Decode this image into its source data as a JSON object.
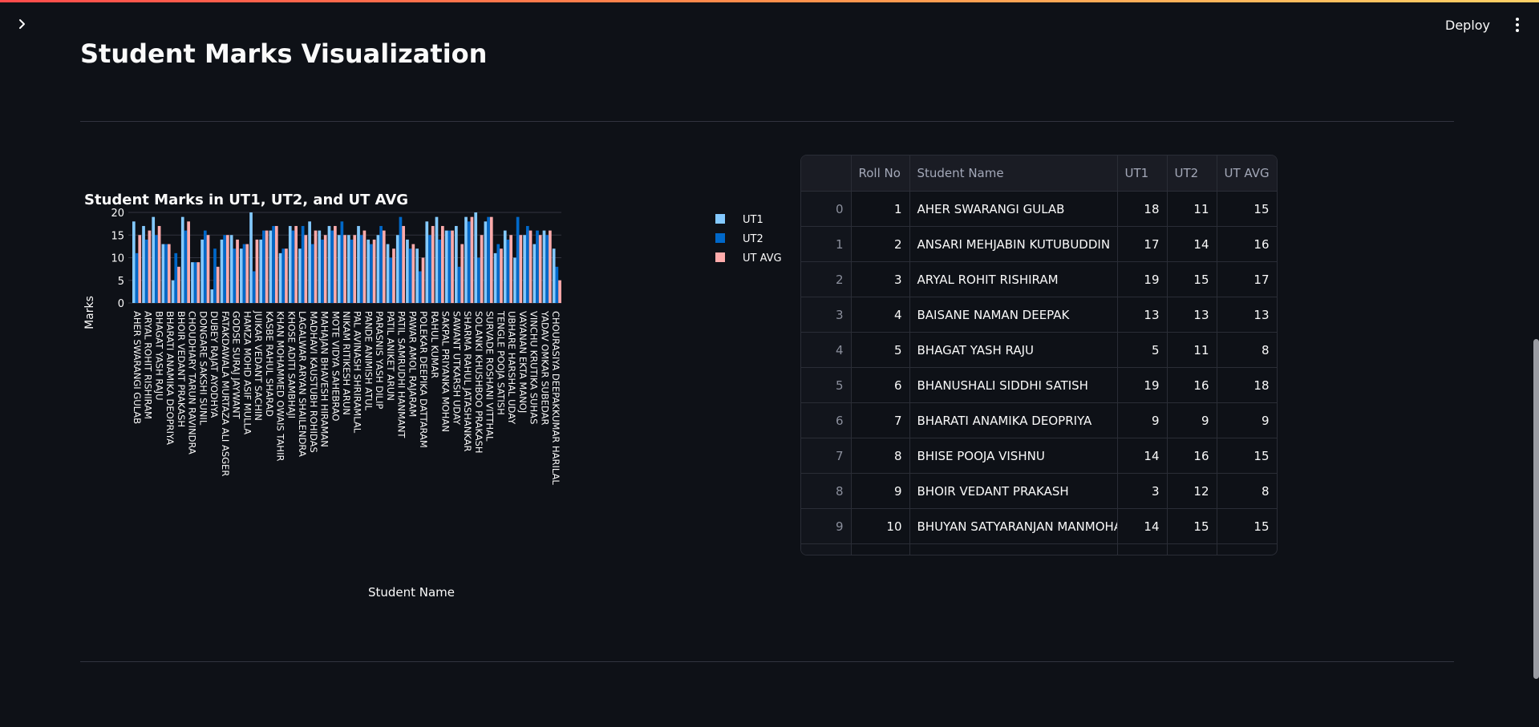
{
  "app": {
    "deploy_label": "Deploy",
    "page_title": "Student Marks Visualization"
  },
  "icons": {
    "sidebar_toggle": "chevron-right-icon",
    "main_menu": "more-vertical-icon"
  },
  "chart_data": {
    "type": "bar",
    "title": "Student Marks in UT1, UT2, and UT AVG",
    "xlabel": "Student Name",
    "ylabel": "Marks",
    "ylim": [
      0,
      20
    ],
    "yticks": [
      0,
      5,
      10,
      15,
      20
    ],
    "grid": true,
    "legend_placement": "right",
    "colors": {
      "UT1": "#83c9ff",
      "UT2": "#0068c9",
      "UT AVG": "#ffabab"
    },
    "categories": [
      "AHER SWARANGI GULAB",
      "ANSARI MEHJABIN KUTUBUDDIN",
      "ARYAL ROHIT RISHIRAM",
      "BAISANE NAMAN DEEPAK",
      "BHAGAT YASH RAJU",
      "BHANUSHALI SIDDHI SATISH",
      "BHARATI ANAMIKA DEOPRIYA",
      "BHISE POOJA VISHNU",
      "BHOIR VEDANT PRAKASH",
      "BHUYAN SATYARANJAN MANMOHAN",
      "CHOUDHARY TARUN RAVINDRA",
      "CHOURASIYA DEEPAKKUMAR HARILAL",
      "DONGARE SAKSHI SUNIL",
      "DUBEY RAJAT AYODHYA",
      "FATAKDAWALA MURTAZA ALI ASGER",
      "GODSE SURAJ JAYWANT",
      "HAMZA MOHD ASIF MULLA",
      "JUIKAR VEDANT SACHIN",
      "KASBE RAHUL SHARAD",
      "KHAN MOHAMMED OWAIS TAHIR",
      "KHOSE ADITI SAMBHAJI",
      "LAGALWAR ARYAN SHAILENDRA",
      "MADHAVI KAUSTUBH ROHIDAS",
      "MAHAJAN BHAVESH HIRAMAN",
      "MOTE VIDYA SAHEBRAO",
      "NIKAM RITIKESH ARUN",
      "PAL AVINASH SHRIRAMLAL",
      "PANDE ANIMISH ATUL",
      "PARASNIS YASH DILIP",
      "PATIL ANIKET ARUN",
      "PATIL SAMRUDHI HANMANT",
      "PAWAR AMOL RAJARAM",
      "POLEKAR DEEPIKA DATTARAM",
      "RAHUL KUMAR",
      "SAKPAL PRIYANKA MOHAN",
      "SAWANT UTKARSH UDAY",
      "SHARMA RAHUL JATASHANKAR",
      "SOLANKI KHUSHBOO PRAKASH",
      "SURVADE ROSHANI VITTHAL",
      "TENGLE POOJA SATISH",
      "UBHARE HARSHAL UDAY",
      "VAYANAN EKTA MANOJ",
      "VINCHU KRUTIKA SUHAS",
      "YADAV OMKAR SUBEDAR"
    ],
    "tick_labels_shown": [
      "AHER SWARANGI GULAB",
      "ARYAL ROHIT RISHIRAM",
      "BHAGAT YASH RAJU",
      "BHARATI ANAMIKA DEOPRIYA",
      "BHOIR VEDANT PRAKASH",
      "CHOUDHARY TARUN RAVINDRA",
      "DONGARE SAKSHI SUNIL",
      "DUBEY RAJAT AYODHYA",
      "FATAKDAWALA MURTAZA ALI ASGER",
      "GODSE SURAJ JAYWANT",
      "HAMZA MOHD ASIF MULLA",
      "JUIKAR VEDANT SACHIN",
      "KASBE RAHUL SHARAD",
      "KHAN MOHAMMED OWAIS TAHIR",
      "KHOSE ADITI SAMBHAJI",
      "LAGALWAR ARYAN SHAILENDRA",
      "MADHAVI KAUSTUBH ROHIDAS",
      "MAHAJAN BHAVESH HIRAMAN",
      "MOTE VIDYA SAHEBRAO",
      "NIKAM RITIKESH ARUN",
      "PAL AVINASH SHRIRAMLAL",
      "PANDE ANIMISH ATUL",
      "PARASNIS YASH DILIP",
      "PATIL ANIKET ARUN",
      "PATIL SAMRUDHI HANMANT",
      "PAWAR AMOL RAJARAM",
      "POLEKAR DEEPIKA DATTARAM",
      "RAHUL KUMAR",
      "SAKPAL PRIYANKA MOHAN",
      "SAWANT UTKARSH UDAY",
      "SHARMA RAHUL JATASHANKAR",
      "SOLANKI KHUSHBOO PRAKASH",
      "SURVADE ROSHANI VITTHAL",
      "TENGLE POOJA SATISH",
      "UBHARE HARSHAL UDAY",
      "VAYANAN EKTA MANOJ",
      "VINCHU KRUTIKA SUHAS",
      "YADAV OMKAR SUBEDAR",
      "CHOURASIYA DEEPAKKUMAR HARILAL"
    ],
    "series": [
      {
        "name": "UT1",
        "values": [
          18,
          17,
          19,
          13,
          5,
          19,
          9,
          14,
          3,
          14,
          15,
          12,
          20,
          14,
          16,
          11,
          17,
          12,
          18,
          16,
          17,
          15,
          15,
          17,
          14,
          15,
          13,
          15,
          14,
          12,
          18,
          19,
          16,
          17,
          19,
          20,
          18,
          11,
          16,
          10,
          15,
          13,
          16,
          12
        ]
      },
      {
        "name": "UT2",
        "values": [
          11,
          14,
          15,
          13,
          11,
          16,
          9,
          16,
          12,
          15,
          12,
          13,
          7,
          16,
          17,
          12,
          16,
          17,
          13,
          14,
          16,
          18,
          14,
          15,
          13,
          17,
          10,
          19,
          12,
          7,
          15,
          14,
          16,
          8,
          18,
          10,
          19,
          13,
          14,
          19,
          17,
          16,
          15,
          8
        ]
      },
      {
        "name": "UT AVG",
        "values": [
          15,
          16,
          17,
          13,
          8,
          18,
          9,
          15,
          8,
          15,
          14,
          13,
          14,
          16,
          17,
          12,
          17,
          15,
          16,
          15,
          17,
          15,
          15,
          16,
          14,
          16,
          12,
          17,
          13,
          10,
          17,
          17,
          16,
          13,
          19,
          15,
          19,
          12,
          15,
          15,
          16,
          15,
          16,
          5
        ]
      }
    ]
  },
  "table": {
    "index_header": "",
    "columns": [
      "Roll No",
      "Student Name",
      "UT1",
      "UT2",
      "UT AVG"
    ],
    "rows": [
      {
        "idx": "0",
        "roll": "1",
        "name": "AHER SWARANGI GULAB",
        "ut1": "18",
        "ut2": "11",
        "avg": "15"
      },
      {
        "idx": "1",
        "roll": "2",
        "name": "ANSARI MEHJABIN KUTUBUDDIN",
        "ut1": "17",
        "ut2": "14",
        "avg": "16"
      },
      {
        "idx": "2",
        "roll": "3",
        "name": "ARYAL ROHIT RISHIRAM",
        "ut1": "19",
        "ut2": "15",
        "avg": "17"
      },
      {
        "idx": "3",
        "roll": "4",
        "name": "BAISANE NAMAN DEEPAK",
        "ut1": "13",
        "ut2": "13",
        "avg": "13"
      },
      {
        "idx": "4",
        "roll": "5",
        "name": "BHAGAT YASH RAJU",
        "ut1": "5",
        "ut2": "11",
        "avg": "8"
      },
      {
        "idx": "5",
        "roll": "6",
        "name": "BHANUSHALI SIDDHI SATISH",
        "ut1": "19",
        "ut2": "16",
        "avg": "18"
      },
      {
        "idx": "6",
        "roll": "7",
        "name": "BHARATI ANAMIKA DEOPRIYA",
        "ut1": "9",
        "ut2": "9",
        "avg": "9"
      },
      {
        "idx": "7",
        "roll": "8",
        "name": "BHISE POOJA VISHNU",
        "ut1": "14",
        "ut2": "16",
        "avg": "15"
      },
      {
        "idx": "8",
        "roll": "9",
        "name": "BHOIR VEDANT PRAKASH",
        "ut1": "3",
        "ut2": "12",
        "avg": "8"
      },
      {
        "idx": "9",
        "roll": "10",
        "name": "BHUYAN SATYARANJAN MANMOHAN",
        "ut1": "14",
        "ut2": "15",
        "avg": "15"
      },
      {
        "idx": "",
        "roll": "",
        "name": "",
        "ut1": "",
        "ut2": "",
        "avg": ""
      }
    ]
  }
}
